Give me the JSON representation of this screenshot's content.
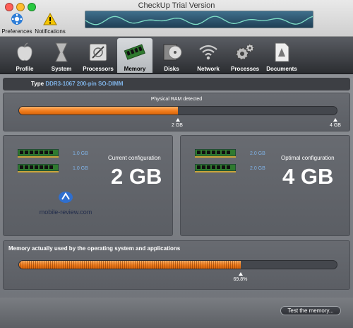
{
  "window": {
    "title": "CheckUp Trial Version"
  },
  "toolbar": {
    "preferences_label": "Preferences",
    "notifications_label": "Notifications"
  },
  "tabs": [
    {
      "label": "Profile"
    },
    {
      "label": "System"
    },
    {
      "label": "Processors"
    },
    {
      "label": "Memory",
      "active": true
    },
    {
      "label": "Disks"
    },
    {
      "label": "Network"
    },
    {
      "label": "Processes"
    },
    {
      "label": "Documents"
    }
  ],
  "memory": {
    "type_label": "Type",
    "type_value": "DDR3-1067 200-pin SO-DIMM",
    "physical": {
      "title": "Physical RAM detected",
      "fill_fraction": 0.5,
      "left_tick": "2 GB",
      "right_tick": "4 GB"
    },
    "current": {
      "title": "Current configuration",
      "total": "2 GB",
      "slots": [
        "1.0 GB",
        "1.0 GB"
      ]
    },
    "optimal": {
      "title": "Optimal configuration",
      "total": "4 GB",
      "slots": [
        "2.0 GB",
        "2.0 GB"
      ]
    },
    "usage": {
      "title": "Memory actually used by the operating system and applications",
      "percent": 69.8,
      "percent_label": "69.8%"
    }
  },
  "watermark": {
    "text": "mobile-review.com"
  },
  "footer": {
    "test_button_label": "Test the memory..."
  },
  "colors": {
    "accent_orange": "#f07c1c",
    "value_blue": "#7fb2e6",
    "panel": "#62656b"
  }
}
